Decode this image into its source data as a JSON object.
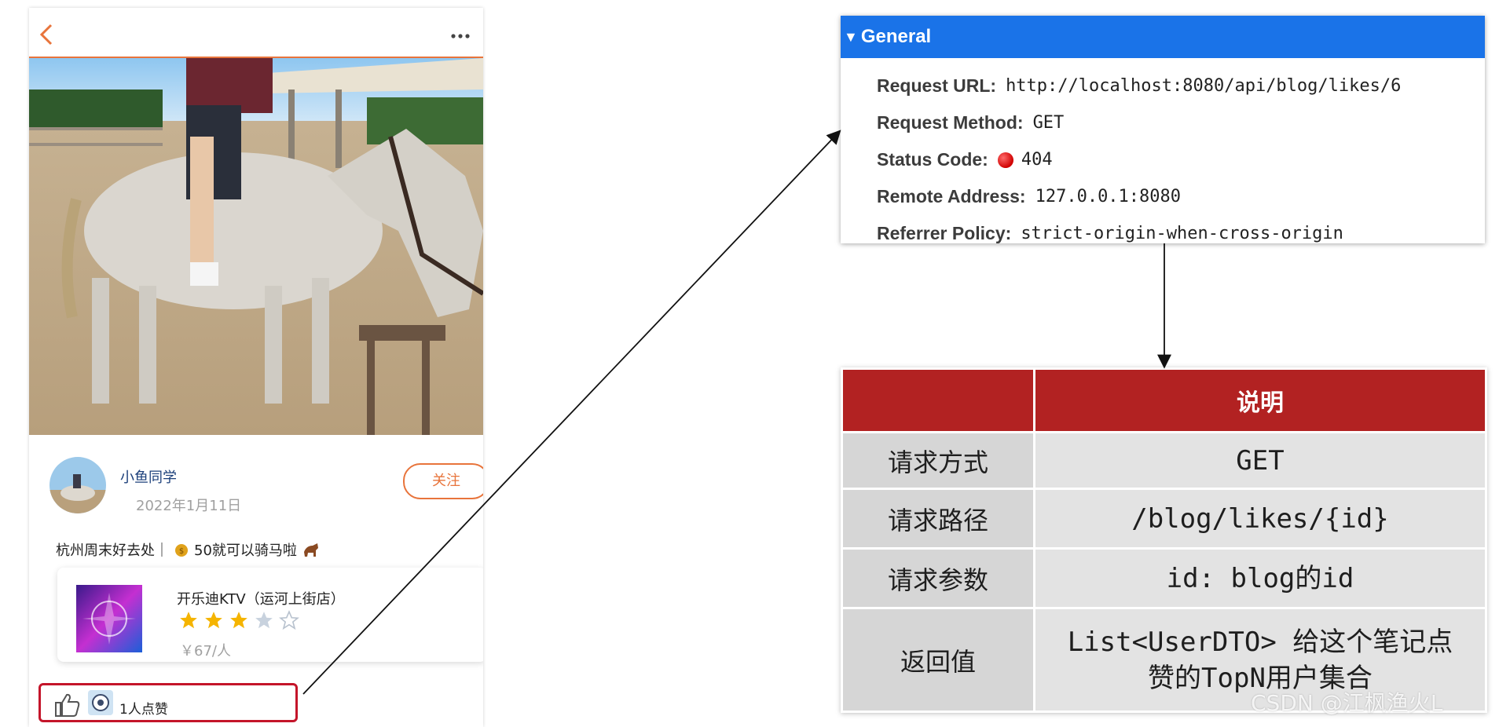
{
  "phone": {
    "post": {
      "author": "小鱼同学",
      "date": "2022年1月11日",
      "follow_label": "关注",
      "text_prefix": "杭州周末好去处｜",
      "text_suffix": "50就可以骑马啦"
    },
    "shop": {
      "name": "开乐迪KTV（运河上街店）",
      "rating": 3,
      "rating_max": 5,
      "price": "￥67/人"
    },
    "likes": {
      "text": "1人点赞"
    }
  },
  "general": {
    "title": "General",
    "rows": [
      {
        "key": "Request URL:",
        "value": "http://localhost:8080/api/blog/likes/6"
      },
      {
        "key": "Request Method:",
        "value": "GET"
      },
      {
        "key": "Status Code:",
        "value": "404"
      },
      {
        "key": "Remote Address:",
        "value": "127.0.0.1:8080"
      },
      {
        "key": "Referrer Policy:",
        "value": "strict-origin-when-cross-origin"
      }
    ]
  },
  "table": {
    "header": [
      "",
      "说明"
    ],
    "rows": [
      {
        "label": "请求方式",
        "value": "GET"
      },
      {
        "label": "请求路径",
        "value": "/blog/likes/{id}"
      },
      {
        "label": "请求参数",
        "value": "id: blog的id"
      },
      {
        "label": "返回值",
        "value_line1": "List<UserDTO> 给这个笔记点",
        "value_line2": "赞的TopN用户集合"
      }
    ]
  },
  "watermark": "CSDN @江枫渔火L",
  "colors": {
    "accent_orange": "#e8743b",
    "highlight_red": "#c4152a",
    "devtools_blue": "#1a73e8",
    "table_header_red": "#b22222",
    "status_error": "#d00000"
  }
}
